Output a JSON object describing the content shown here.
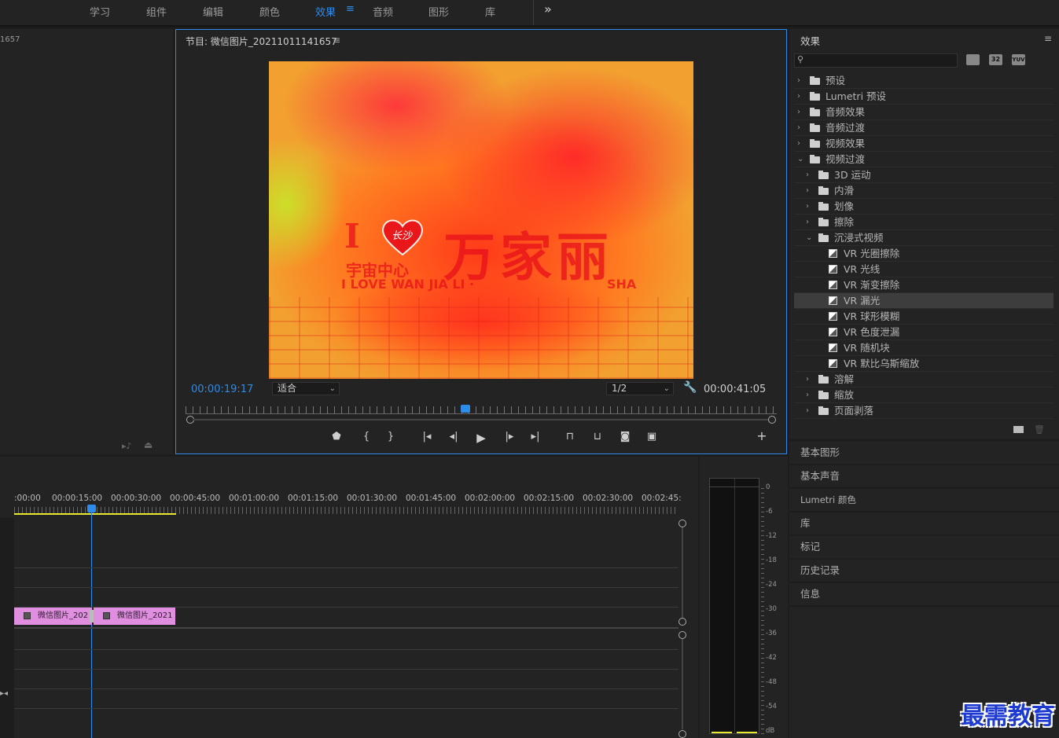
{
  "workspaces": [
    "学习",
    "组件",
    "编辑",
    "颜色",
    "效果",
    "音频",
    "图形",
    "库"
  ],
  "active_workspace": "效果",
  "workspace_menu_icon": "≡",
  "overflow_icon": "»",
  "left_panel": {
    "partial_label": "1657"
  },
  "monitor": {
    "title": "节目: 微信图片_20211011141657",
    "menu_icon": "≡",
    "timecode_current": "00:00:19:17",
    "zoom_label": "适合",
    "resolution_label": "1/2",
    "timecode_duration": "00:00:41:05",
    "playhead_position": 0.47,
    "video_text": {
      "heart_text": "长沙",
      "big": "万家丽",
      "sub": "宇宙中心",
      "love": "I LOVE WAN JIA LI ·",
      "sha": "SHA",
      "i": "I"
    }
  },
  "effects": {
    "title": "效果",
    "menu_icon": "≡",
    "search_placeholder": "",
    "badges": [
      "32",
      "YUV"
    ],
    "items": [
      {
        "label": "预设",
        "level": 0,
        "type": "star-folder",
        "expanded": false
      },
      {
        "label": "Lumetri 预设",
        "level": 0,
        "type": "star-folder",
        "expanded": false
      },
      {
        "label": "音频效果",
        "level": 0,
        "type": "folder",
        "expanded": false
      },
      {
        "label": "音频过渡",
        "level": 0,
        "type": "folder",
        "expanded": false
      },
      {
        "label": "视频效果",
        "level": 0,
        "type": "folder",
        "expanded": false
      },
      {
        "label": "视频过渡",
        "level": 0,
        "type": "folder",
        "expanded": true
      },
      {
        "label": "3D 运动",
        "level": 1,
        "type": "folder",
        "expanded": false
      },
      {
        "label": "内滑",
        "level": 1,
        "type": "folder",
        "expanded": false
      },
      {
        "label": "划像",
        "level": 1,
        "type": "folder",
        "expanded": false
      },
      {
        "label": "擦除",
        "level": 1,
        "type": "folder",
        "expanded": false
      },
      {
        "label": "沉浸式视频",
        "level": 1,
        "type": "folder",
        "expanded": true
      },
      {
        "label": "VR 光圈擦除",
        "level": 2,
        "type": "effect"
      },
      {
        "label": "VR 光线",
        "level": 2,
        "type": "effect"
      },
      {
        "label": "VR 渐变擦除",
        "level": 2,
        "type": "effect"
      },
      {
        "label": "VR 漏光",
        "level": 2,
        "type": "effect",
        "selected": true
      },
      {
        "label": "VR 球形模糊",
        "level": 2,
        "type": "effect"
      },
      {
        "label": "VR 色度泄漏",
        "level": 2,
        "type": "effect"
      },
      {
        "label": "VR 随机块",
        "level": 2,
        "type": "effect"
      },
      {
        "label": "VR 默比乌斯缩放",
        "level": 2,
        "type": "effect"
      },
      {
        "label": "溶解",
        "level": 1,
        "type": "folder",
        "expanded": false
      },
      {
        "label": "缩放",
        "level": 1,
        "type": "folder",
        "expanded": false
      },
      {
        "label": "页面剥落",
        "level": 1,
        "type": "folder",
        "expanded": false
      }
    ]
  },
  "side_panels": [
    "基本图形",
    "基本声音",
    "Lumetri 颜色",
    "库",
    "标记",
    "历史记录",
    "信息"
  ],
  "timeline": {
    "ruler_labels": [
      ":00:00",
      "00:00:15:00",
      "00:00:30:00",
      "00:00:45:00",
      "00:01:00:00",
      "00:01:15:00",
      "00:01:30:00",
      "00:01:45:00",
      "00:02:00:00",
      "00:02:15:00",
      "00:02:30:00",
      "00:02:45:"
    ],
    "clips": [
      "微信图片_202",
      "微信图片_2021"
    ]
  },
  "meter": {
    "labels": [
      "0",
      "-6",
      "-12",
      "-18",
      "-24",
      "-30",
      "-36",
      "-42",
      "-48",
      "-54",
      "dB"
    ]
  },
  "watermark": "最需教育",
  "colors": {
    "accent": "#2d8ceb",
    "clip": "#e08fe0",
    "work_area": "#e8e830"
  }
}
